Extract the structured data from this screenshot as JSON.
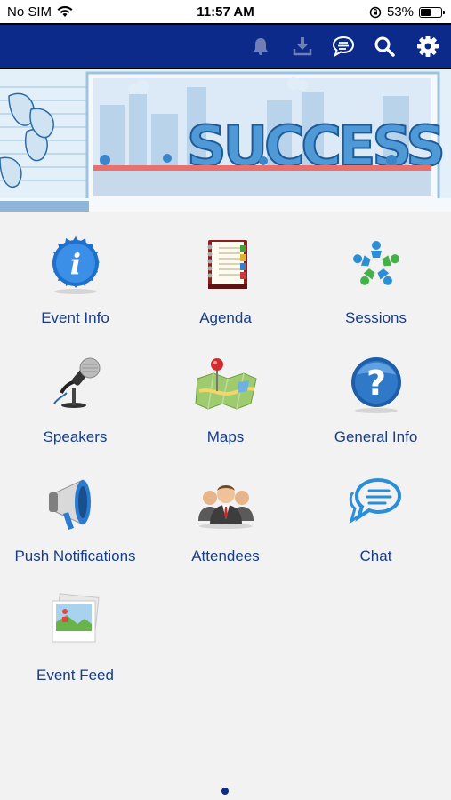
{
  "status_bar": {
    "carrier": "No SIM",
    "time": "11:57 AM",
    "battery": "53%",
    "battery_level": 0.53
  },
  "navbar": {
    "icons": [
      "bell-icon",
      "download-icon",
      "chat-icon",
      "search-icon",
      "gear-icon"
    ]
  },
  "banner": {
    "word": "SUCCESS"
  },
  "tiles": [
    {
      "label": "Event Info",
      "icon": "info-icon"
    },
    {
      "label": "Agenda",
      "icon": "agenda-icon"
    },
    {
      "label": "Sessions",
      "icon": "sessions-icon"
    },
    {
      "label": "Speakers",
      "icon": "microphone-icon"
    },
    {
      "label": "Maps",
      "icon": "map-icon"
    },
    {
      "label": "General Info",
      "icon": "question-icon"
    },
    {
      "label": "Push Notifications",
      "icon": "megaphone-icon"
    },
    {
      "label": "Attendees",
      "icon": "attendees-icon"
    },
    {
      "label": "Chat",
      "icon": "chat-icon"
    },
    {
      "label": "Event Feed",
      "icon": "photo-icon"
    }
  ],
  "pager": {
    "pages": 1,
    "current": 1
  }
}
